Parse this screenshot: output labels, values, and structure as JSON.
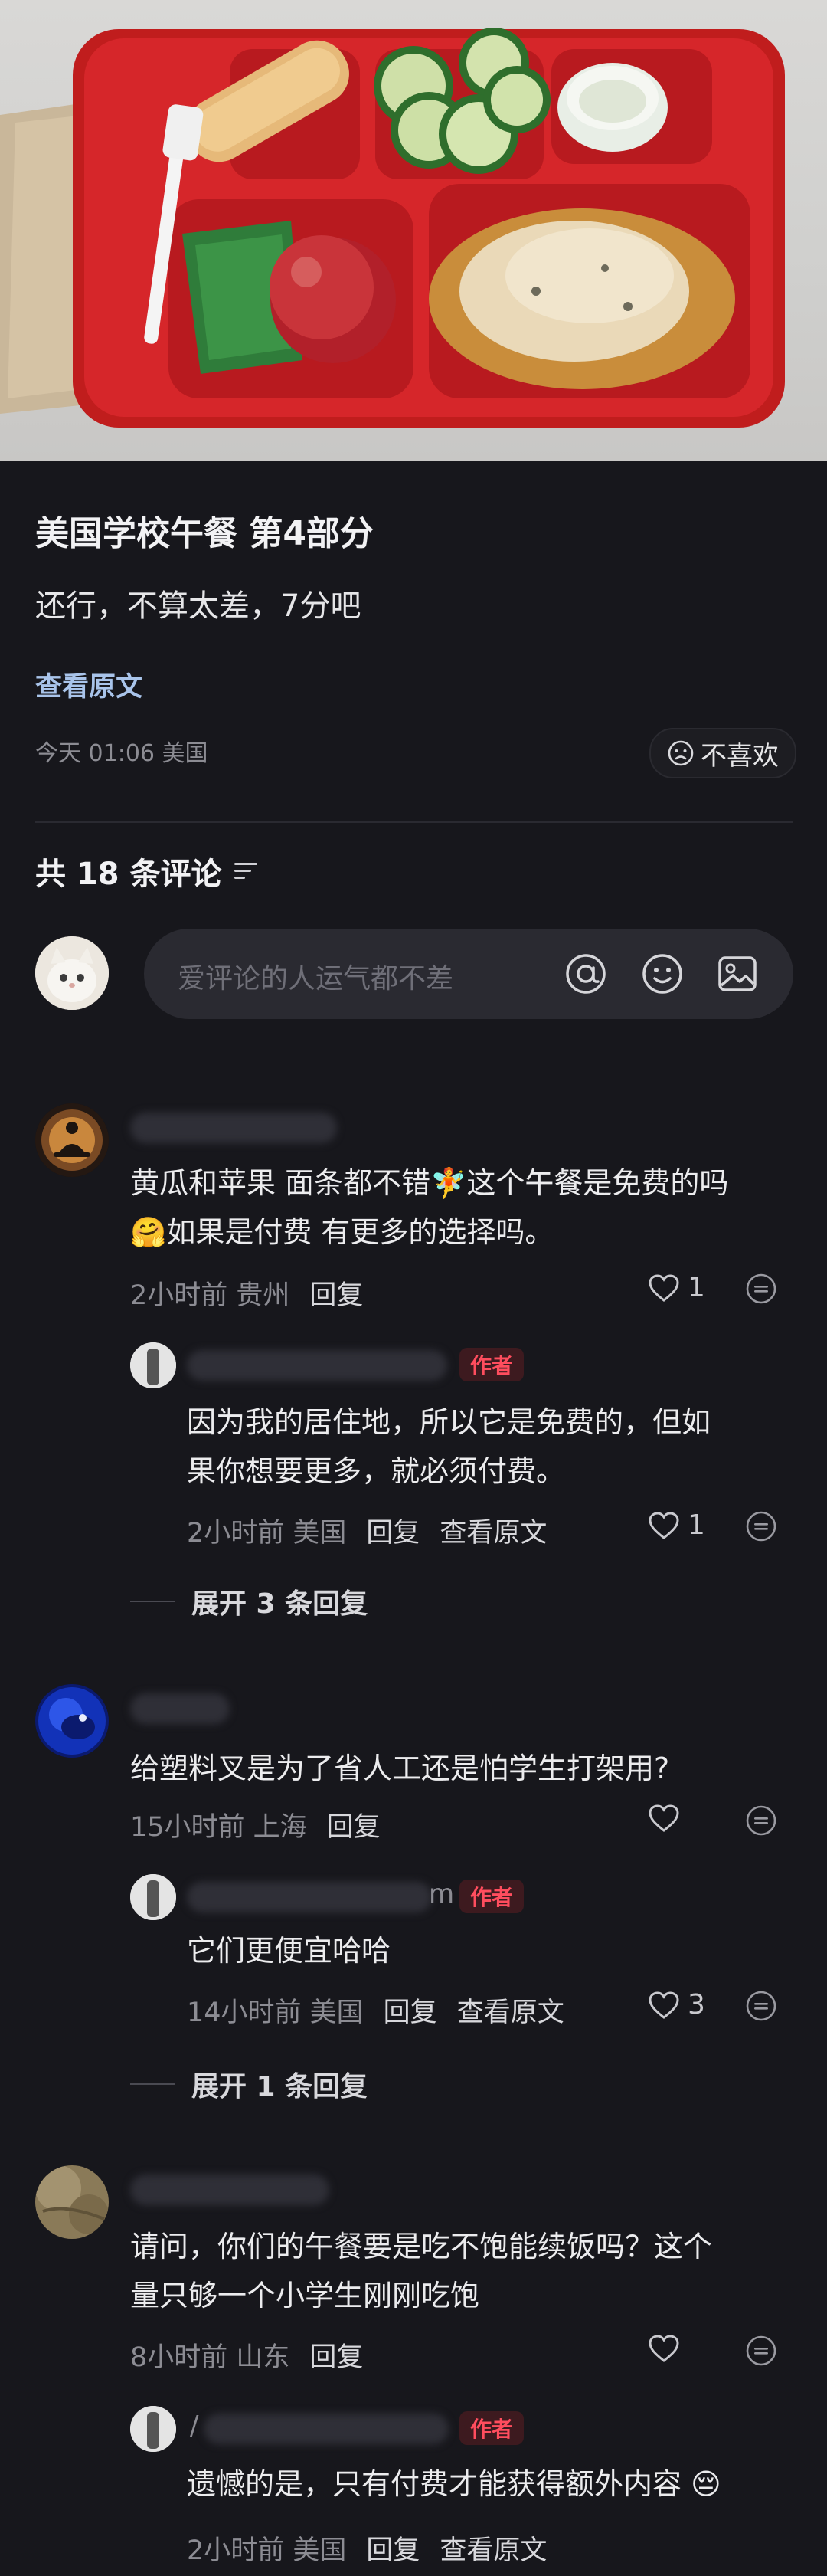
{
  "post": {
    "title": "美国学校午餐 第4部分",
    "body": "还行，不算太差，7分吧",
    "view_original": "查看原文",
    "meta": "今天 01:06 美国",
    "dislike_label": "不喜欢"
  },
  "comments_header": {
    "label": "共 18 条评论"
  },
  "comment_input": {
    "placeholder": "爱评论的人运气都不差"
  },
  "comments": [
    {
      "text_line1": "黄瓜和苹果 面条都不错🧚这个午餐是免费的吗",
      "text_line2": "🤗如果是付费 有更多的选择吗。",
      "time": "2小时前 贵州",
      "reply": "回复",
      "likes": "1",
      "author_reply": {
        "tag": "作者",
        "text_line1": "因为我的居住地，所以它是免费的，但如",
        "text_line2": "果你想要更多，就必须付费。",
        "time": "2小时前 美国",
        "reply": "回复",
        "view_original": "查看原文",
        "likes": "1"
      },
      "expand": "展开 3 条回复"
    },
    {
      "text_line1": "给塑料叉是为了省人工还是怕学生打架用?",
      "time": "15小时前 上海",
      "reply": "回复",
      "likes": "",
      "author_reply": {
        "tag": "作者",
        "name_tail": "m",
        "text_line1": "它们更便宜哈哈",
        "time": "14小时前 美国",
        "reply": "回复",
        "view_original": "查看原文",
        "likes": "3"
      },
      "expand": "展开 1 条回复"
    },
    {
      "text_line1": "请问，你们的午餐要是吃不饱能续饭吗？这个",
      "text_line2": "量只够一个小学生刚刚吃饱",
      "time": "8小时前 山东",
      "reply": "回复",
      "likes": "",
      "author_reply": {
        "tag": "作者",
        "name_head": "/",
        "text_line1": "遗憾的是，只有付费才能获得额外内容 😔",
        "time": "2小时前 美国",
        "reply": "回复",
        "view_original": "查看原文"
      }
    }
  ],
  "icons": [
    "at-icon",
    "emoji-icon",
    "image-icon",
    "heart-icon",
    "more-icon",
    "filter-icon",
    "dislike-face-icon"
  ]
}
